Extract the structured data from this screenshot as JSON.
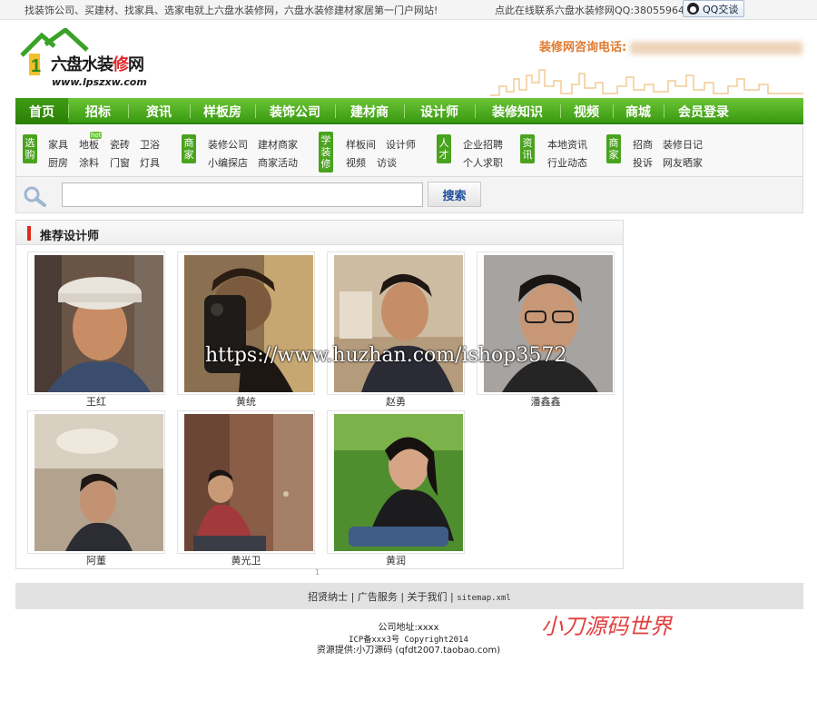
{
  "topbar": {
    "slogan": "找装饰公司、买建材、找家具、选家电就上六盘水装修网，六盘水装修建材家居第一门户网站!",
    "qq_text": "点此在线联系六盘水装修网QQ:380559645",
    "qq_button": "QQ交谈"
  },
  "logo": {
    "name_a": "六盘水装",
    "name_b": "修",
    "name_c": "网",
    "url": "www.lpszxw.com"
  },
  "hotline": {
    "label": "装修网咨询电话:"
  },
  "nav": [
    "首页",
    "招标",
    "资讯",
    "样板房",
    "装饰公司",
    "建材商",
    "设计师",
    "装修知识",
    "视频",
    "商城",
    "会员登录"
  ],
  "subnav": {
    "groups": [
      {
        "tag": "选购",
        "links": [
          "家具",
          "地板",
          "瓷砖",
          "卫浴",
          "厨房",
          "涂料",
          "门窗",
          "灯具"
        ],
        "badge": "hot"
      },
      {
        "tag": "商家",
        "links": [
          "装修公司",
          "建材商家",
          "小编探店",
          "商家活动"
        ]
      },
      {
        "tag": "学装修",
        "links": [
          "样板间",
          "设计师",
          "视频",
          "访谈"
        ]
      },
      {
        "tag": "人才",
        "links": [
          "企业招聘",
          "个人求职"
        ]
      },
      {
        "tag": "资讯",
        "links": [
          "本地资讯",
          "行业动态"
        ]
      },
      {
        "tag": "商家",
        "links": [
          "招商",
          "装修日记",
          "投诉",
          "网友晒家"
        ]
      }
    ]
  },
  "search": {
    "value": "",
    "button": "搜索"
  },
  "panel": {
    "title": "推荐设计师"
  },
  "designers": [
    "王红",
    "黄统",
    "赵勇",
    "潘鑫鑫",
    "阿董",
    "黄光卫",
    "黄润"
  ],
  "pager": "1",
  "footer": {
    "links": [
      "招贤纳士",
      "广告服务",
      "关于我们",
      "sitemap.xml"
    ],
    "address": "公司地址:xxxx",
    "icp": "ICP备xxx3号 Copyright2014",
    "source": "资源提供:小刀源码 (qfdt2007.taobao.com)"
  },
  "watermarks": {
    "brand": "小刀源码世界",
    "url": "https://www.huzhan.com/ishop3572"
  },
  "colors": {
    "nav_green": "#4aa31e",
    "accent_red": "#e02a1a",
    "hotline_orange": "#e07a2e",
    "link_blue": "#1e4f9a"
  }
}
